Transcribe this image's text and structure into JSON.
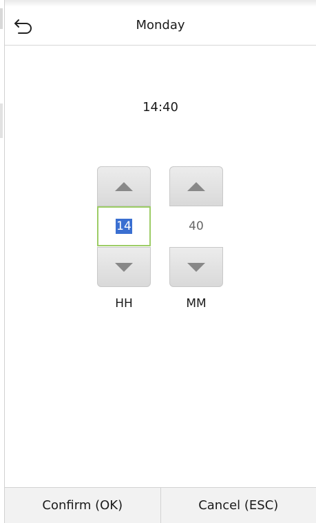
{
  "header": {
    "title": "Monday",
    "back_icon": "back-arrow-icon"
  },
  "time_display": "14:40",
  "hour": {
    "value": "14",
    "label": "HH",
    "up_icon": "arrow-up-icon",
    "down_icon": "arrow-down-icon"
  },
  "minute": {
    "value": "40",
    "label": "MM",
    "up_icon": "arrow-up-icon",
    "down_icon": "arrow-down-icon"
  },
  "footer": {
    "confirm_label": "Confirm (OK)",
    "cancel_label": "Cancel (ESC)"
  },
  "colors": {
    "active_border": "#9ccc65",
    "selection": "#3a6fd1",
    "arrow": "#888888"
  }
}
